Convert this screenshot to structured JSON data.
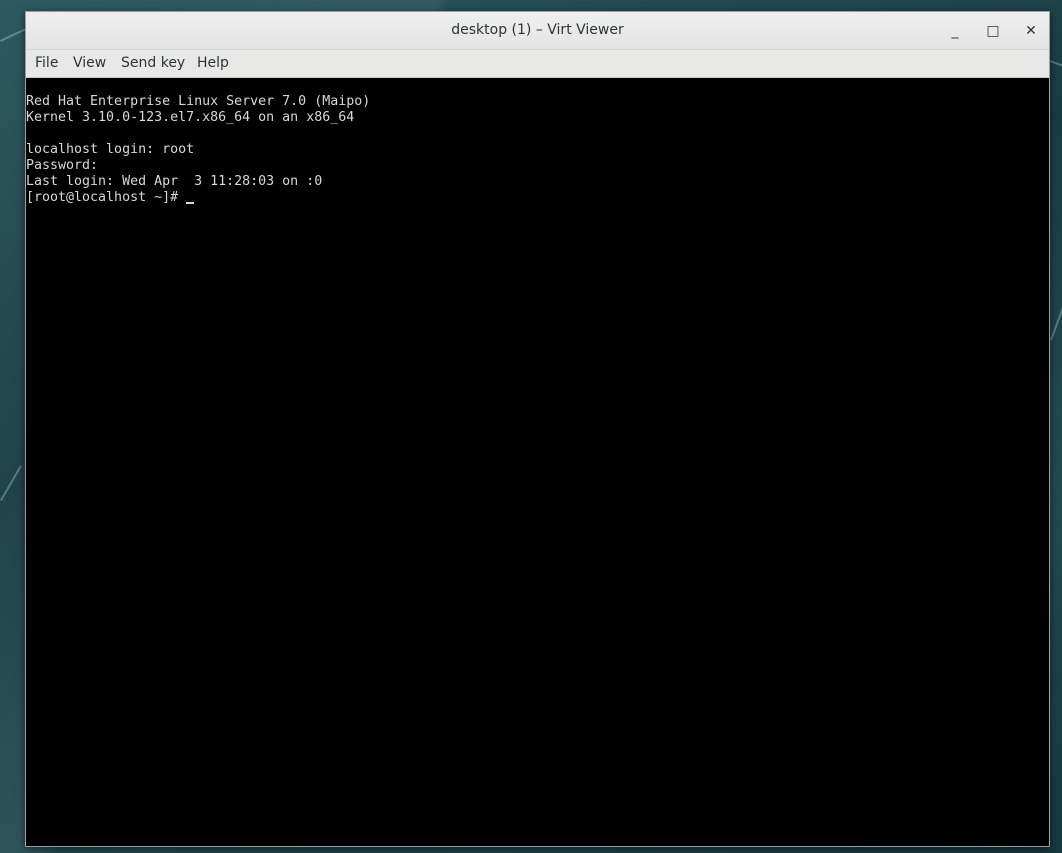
{
  "window": {
    "title": "desktop (1) – Virt Viewer",
    "minimize_glyph": "_",
    "maximize_glyph": "□",
    "close_glyph": "✕"
  },
  "menu": {
    "file": "File",
    "view": "View",
    "send_key": "Send key",
    "help": "Help"
  },
  "console": {
    "lines": [
      "Red Hat Enterprise Linux Server 7.0 (Maipo)",
      "Kernel 3.10.0-123.el7.x86_64 on an x86_64",
      "",
      "localhost login: root",
      "Password:",
      "Last login: Wed Apr  3 11:28:03 on :0",
      "[root@localhost ~]# "
    ]
  }
}
